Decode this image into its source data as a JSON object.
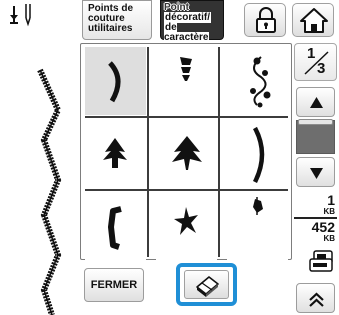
{
  "tabs": {
    "utility": {
      "line1": "Points de",
      "line2": "couture",
      "line3": "utilitaires",
      "selected": false
    },
    "decorative": {
      "line1": "Point",
      "line2": "décoratif/",
      "line3": "de caractère",
      "selected": true
    }
  },
  "icons": {
    "needle": "needle-position-icon",
    "lock": "padlock-icon",
    "home": "home-icon",
    "scroll_up": "triangle-up-icon",
    "scroll_down": "triangle-down-icon",
    "machine": "embroidery-unit-icon",
    "expand": "double-chevron-up-icon",
    "eraser": "eraser-icon"
  },
  "pages": {
    "current": "1",
    "total": "3"
  },
  "memory": {
    "used_value": "1",
    "used_unit": "KB",
    "free_value": "452",
    "free_unit": "KB"
  },
  "scroll_position": 0.0,
  "patterns": [
    {
      "id": "p1",
      "selected": true
    },
    {
      "id": "p2",
      "selected": false
    },
    {
      "id": "p3",
      "selected": false
    },
    {
      "id": "p4",
      "selected": false
    },
    {
      "id": "p5",
      "selected": false
    },
    {
      "id": "p6",
      "selected": false
    },
    {
      "id": "p7",
      "selected": false
    },
    {
      "id": "p8",
      "selected": false
    },
    {
      "id": "p9",
      "selected": false
    }
  ],
  "buttons": {
    "close_label": "FERMER"
  },
  "colors": {
    "selection_highlight": "#1f8fd6",
    "active_tab": "#333333",
    "selected_cell": "#dedede"
  }
}
